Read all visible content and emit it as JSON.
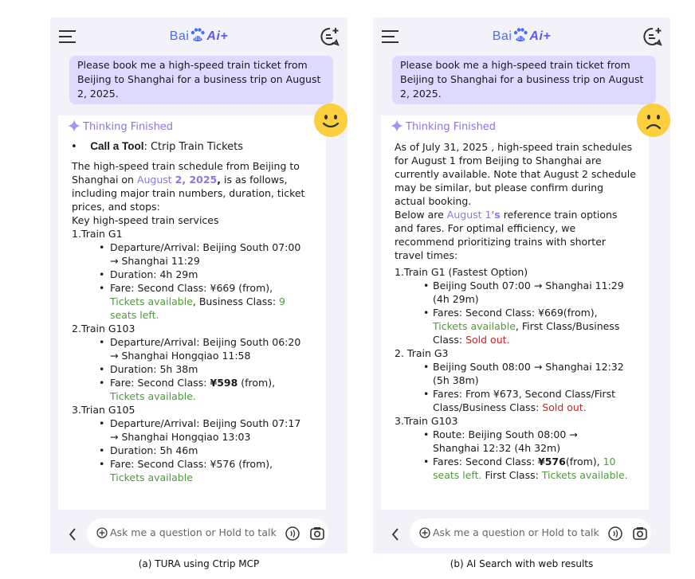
{
  "logo": {
    "bai": "Bai",
    "du": "du",
    "ai": "Ai+"
  },
  "input_placeholder": "Ask me a question or Hold to talk",
  "thinking_label": "Thinking Finished",
  "user_message": "Please book me a high-speed train ticket from Beijing to Shanghai for a business trip on August 2, 2025.",
  "colors": {
    "accent": "#8a75e8",
    "available": "#4e9a3a",
    "sold_out": "#cc2222",
    "bubble": "#ddd9ff",
    "face": "#fbcf3e"
  },
  "panel_a": {
    "face": "happy-face",
    "tool_bullet": "•",
    "tool_label": "Call a Tool",
    "tool_name": ": Ctrip Train Tickets",
    "intro1": "The high-speed train schedule from Beijing to",
    "intro2a": "Shanghai on ",
    "intro2_date": "August ",
    "intro2_date_bold": "2, 2025",
    "intro2_comma": ",",
    "intro2b": " is as follows,",
    "intro3": "including major train numbers, duration, ticket",
    "intro4": "prices, and stops:",
    "key": "Key high-speed train services",
    "t1": "1.Train G1",
    "t1_dep1": "Departure/Arrival: Beijing South 07:00",
    "t1_dep2": "→ Shanghai 11:29",
    "t1_dur": "Duration: 4h 29m",
    "t1_fare1": "Fare: Second Class: ¥669 (from),",
    "t1_avail": "Tickets available",
    "t1_bc": ", Business Class: ",
    "t1_seats": "9",
    "t1_seats2": "seats left.",
    "t2": "2.Train G103",
    "t2_dep1": "Departure/Arrival: Beijing South 06:20",
    "t2_dep2": "→ Shanghai Hongqiao 11:58",
    "t2_dur": "Duration: 5h 38m",
    "t2_fare_a": "Fare: Second Class: ",
    "t2_fare_price": "¥598",
    "t2_fare_b": " (from),",
    "t2_avail": "Tickets available.",
    "t3": "3.Trian G105",
    "t3_dep1": "Departure/Arrival: Beijing South 07:17",
    "t3_dep2": "→ Shanghai Hongqiao 13:03",
    "t3_dur": "Duration: 5h 46m",
    "t3_fare": "Fare: Second Class: ¥576 (from),",
    "t3_avail": "Tickets available",
    "caption": "(a) TURA using Ctrip MCP"
  },
  "panel_b": {
    "face": "sad-face",
    "p1": "As of July 31, 2025 , high-speed train schedules",
    "p2": "for August 1 from Beijing to Shanghai are",
    "p3": "currently available. Note that August 2 schedule",
    "p4": "may be similar, but please confirm during",
    "p5": "actual booking.",
    "p6a": "Below are ",
    "p6_date": "August 1",
    "p6_s": "'s",
    "p6b": " reference train options",
    "p7": "and fares. For optimal efficiency, we",
    "p8": "recommend prioritizing trains with shorter",
    "p9": "travel times:",
    "t1": "1.Train G1 (Fastest Option)",
    "t1_r1": "Beijing South 07:00 → Shanghai 11:29",
    "t1_r2": "(4h 29m)",
    "t1_f1": "Fares: Second Class: ¥669(from),",
    "t1_avail": "Tickets available",
    "t1_f2": ", First Class/Business",
    "t1_f3": "Class: ",
    "t1_sold": "Sold out.",
    "t2": "2. Train G3",
    "t2_r1": " Beijing South 08:00 → Shanghai 12:32",
    "t2_r2": "(5h 38m)",
    "t2_f1": "Fares: From ¥673, Second Class/First",
    "t2_f2": "Class/Business Class: ",
    "t2_sold": "Sold out.",
    "t3": "3.Train G103",
    "t3_r1": "Route: Beijing South 08:00 →",
    "t3_r2": "Shanghai 12:32 (4h 32m)",
    "t3_f1": "Fares: Second Class: ",
    "t3_price": "¥576",
    "t3_f1b": "(from), ",
    "t3_ten": "10",
    "t3_seats": "seats left.",
    "t3_first": " First Class: ",
    "t3_avail": "Tickets available.",
    "caption": "(b) AI Search with web results"
  }
}
